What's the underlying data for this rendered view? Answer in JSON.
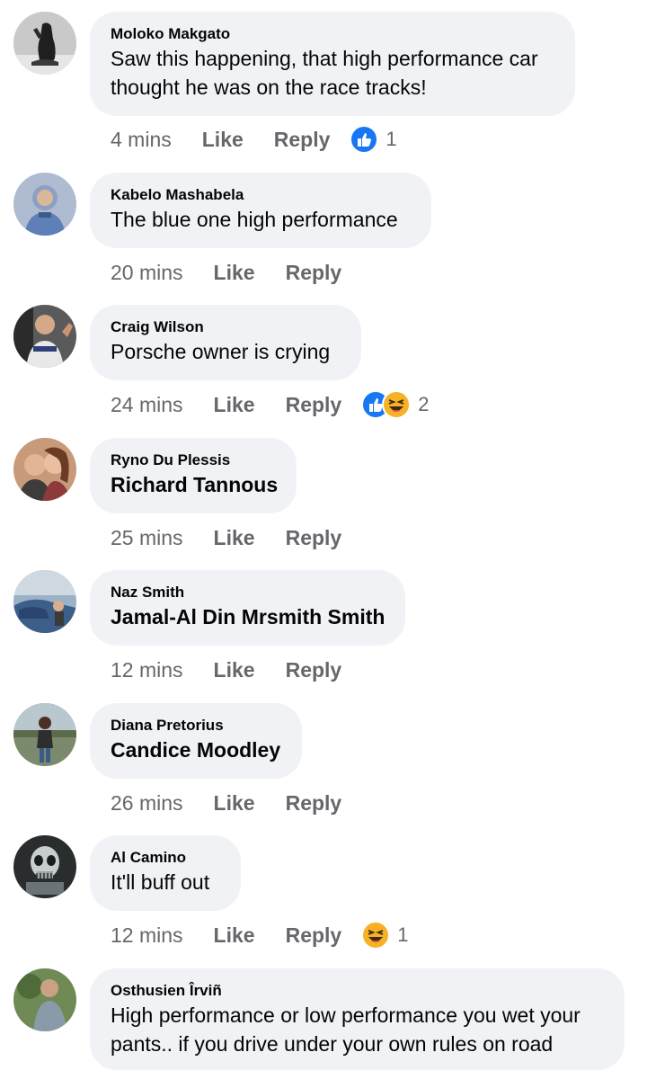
{
  "colors": {
    "bubble_bg": "#f0f2f5",
    "secondary_text": "#65676b",
    "primary_text": "#050505",
    "like_blue": "#1877f2",
    "haha_yellow": "#f7b125"
  },
  "comments": [
    {
      "author": "Moloko Makgato",
      "lines": [
        "Saw this happening, that high performance car",
        "thought he was on the race tracks!"
      ],
      "time": "4 mins",
      "like_label": "Like",
      "reply_label": "Reply",
      "reactions": [
        "like-icon"
      ],
      "reaction_count": "1"
    },
    {
      "author": "Kabelo Mashabela",
      "lines": [
        "The blue one high performance"
      ],
      "time": "20 mins",
      "like_label": "Like",
      "reply_label": "Reply",
      "reactions": [],
      "reaction_count": ""
    },
    {
      "author": "Craig Wilson",
      "lines": [
        "Porsche owner is crying"
      ],
      "time": "24 mins",
      "like_label": "Like",
      "reply_label": "Reply",
      "reactions": [
        "like-icon",
        "haha-icon"
      ],
      "reaction_count": "2"
    },
    {
      "author": "Ryno Du Plessis",
      "lines": [
        "Richard Tannous"
      ],
      "mention": true,
      "time": "25 mins",
      "like_label": "Like",
      "reply_label": "Reply",
      "reactions": [],
      "reaction_count": ""
    },
    {
      "author": "Naz Smith",
      "lines": [
        "Jamal-Al Din Mrsmith Smith"
      ],
      "mention": true,
      "time": "12 mins",
      "like_label": "Like",
      "reply_label": "Reply",
      "reactions": [],
      "reaction_count": ""
    },
    {
      "author": "Diana Pretorius",
      "lines": [
        "Candice Moodley"
      ],
      "mention": true,
      "time": "26 mins",
      "like_label": "Like",
      "reply_label": "Reply",
      "reactions": [],
      "reaction_count": ""
    },
    {
      "author": "Al Camino",
      "lines": [
        "It'll buff out"
      ],
      "time": "12 mins",
      "like_label": "Like",
      "reply_label": "Reply",
      "reactions": [
        "haha-icon"
      ],
      "reaction_count": "1"
    },
    {
      "author": "Osthusien Îrviñ",
      "lines": [
        "High performance or low performance you wet your",
        "pants.. if you drive under your own rules on road"
      ],
      "time": "",
      "like_label": "",
      "reply_label": "",
      "reactions": [],
      "reaction_count": ""
    }
  ]
}
